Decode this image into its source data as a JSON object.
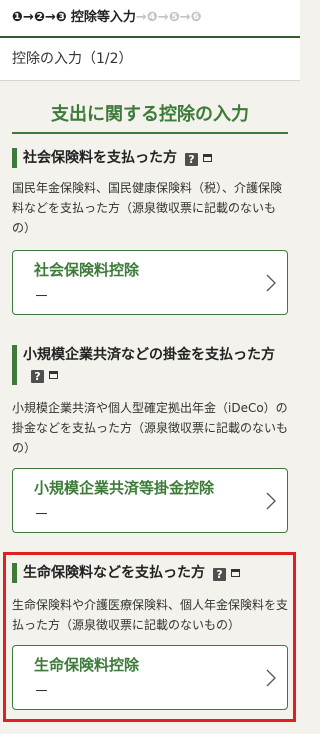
{
  "colors": {
    "accent": "#3e7b3a",
    "background": "#f3f2ec",
    "text": "#333333",
    "highlight_border": "#e02020",
    "step_upcoming": "#c4c4c4"
  },
  "icons": {
    "help": "help-icon",
    "new_window": "new-window-icon",
    "card_arrow": "chevron-right-icon"
  },
  "steps": {
    "arrow": "→",
    "completed": [
      "❶",
      "❷"
    ],
    "current": {
      "number": "❸",
      "label": "控除等入力"
    },
    "upcoming": [
      "❹",
      "❺",
      "❻"
    ]
  },
  "subheader": {
    "title": "控除の入力（1/2）"
  },
  "page_heading": "支出に関する控除の入力",
  "sections": [
    {
      "title": "社会保険料を支払った方",
      "description": "国民年金保険料、国民健康保険料（税）、介護保険料などを支払った方（源泉徴収票に記載のないもの）",
      "card": {
        "title": "社会保険料控除",
        "amount": "－"
      }
    },
    {
      "title": "小規模企業共済などの掛金を支払った方",
      "description": "小規模企業共済や個人型確定拠出年金（iDeCo）の掛金などを支払った方（源泉徴収票に記載のないもの）",
      "card": {
        "title": "小規模企業共済等掛金控除",
        "amount": "－"
      }
    },
    {
      "title": "生命保険料などを支払った方",
      "description": "生命保険料や介護医療保険料、個人年金保険料を支払った方（源泉徴収票に記載のないもの）",
      "card": {
        "title": "生命保険料控除",
        "amount": "－"
      }
    }
  ]
}
